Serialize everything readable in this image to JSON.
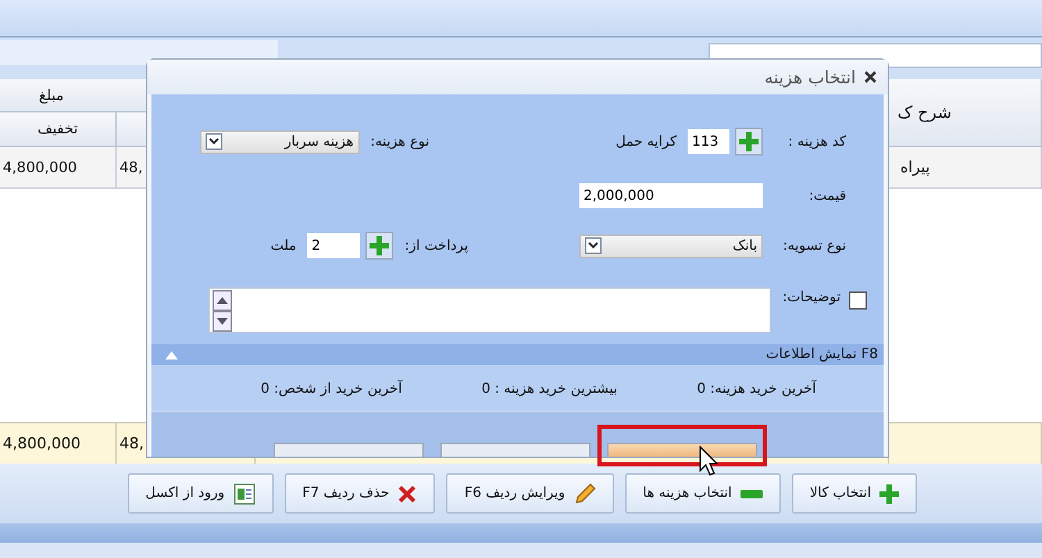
{
  "table": {
    "amount_group": "مبلغ",
    "discount_column": "تخفیف",
    "description_column": "شرح ک",
    "rows": [
      {
        "discount": "4,800,000",
        "column_2": "48,",
        "description": "پیراه"
      }
    ],
    "totals": {
      "discount": "4,800,000",
      "column_2": "48,"
    }
  },
  "dialog": {
    "title": "انتخاب هزینه",
    "cost_code": {
      "label": "کد هزینه :",
      "value": "113",
      "name": "کرایه حمل"
    },
    "cost_type": {
      "label": "نوع هزینه:",
      "value": "هزینه سربار"
    },
    "price": {
      "label": "قیمت:",
      "value": "2,000,000"
    },
    "settlement": {
      "label": "نوع تسویه:",
      "value": "بانک"
    },
    "pay_from": {
      "label": "پرداخت از:",
      "value": "2",
      "name": "ملت"
    },
    "notes": {
      "label": "توضیحات:",
      "checked": false
    },
    "info": {
      "header": "F8 نمایش اطلاعات",
      "expanded": true,
      "items": [
        {
          "label": "آخرین خرید هزینه:",
          "value": "0"
        },
        {
          "label": "بیشترین خرید هزینه :",
          "value": "0"
        },
        {
          "label": "آخرین خرید از شخص:",
          "value": "0"
        }
      ]
    },
    "buttons": [
      {
        "hovered": true
      },
      {
        "hovered": false
      },
      {
        "hovered": false
      }
    ]
  },
  "toolbar": [
    {
      "label": "انتخاب کالا",
      "kind": "plus"
    },
    {
      "label": "انتخاب هزینه ها",
      "kind": "minus"
    },
    {
      "label": "ویرایش ردیف F6",
      "kind": "pencil"
    },
    {
      "label": "حذف ردیف F7",
      "kind": "cross"
    },
    {
      "label": "ورود از اکسل",
      "kind": "sheet"
    }
  ]
}
